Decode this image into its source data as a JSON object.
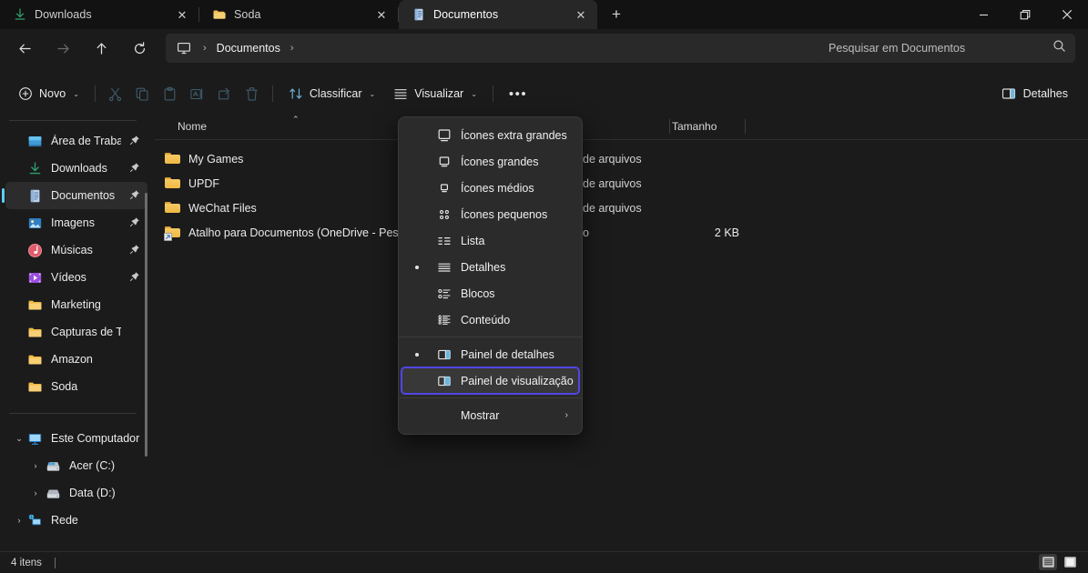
{
  "window": {
    "controls": [
      {
        "name": "minimize",
        "label": "—"
      },
      {
        "name": "maximize",
        "label": "❐"
      },
      {
        "name": "close",
        "label": "✕"
      }
    ]
  },
  "tabs": {
    "items": [
      {
        "label": "Downloads",
        "icon": "download-icon",
        "active": false,
        "close": "✕"
      },
      {
        "label": "Soda",
        "icon": "folder-icon",
        "active": false,
        "close": "✕"
      },
      {
        "label": "Documentos",
        "icon": "documents-icon",
        "active": true,
        "close": "✕"
      }
    ],
    "new_tab_label": "+"
  },
  "address": {
    "back": "back-arrow",
    "forward": "forward-arrow",
    "up": "up-arrow",
    "refresh": "refresh-icon",
    "crumb_icon": "this-pc-icon",
    "crumb_text": "Documentos",
    "sep": "›"
  },
  "search": {
    "placeholder": "Pesquisar em Documentos",
    "value": "",
    "icon": "search-icon"
  },
  "toolbar": {
    "new_label": "Novo",
    "new_chevron": "⌄",
    "cut_label": "Recortar",
    "copy_label": "Copiar",
    "paste_label": "Colar",
    "rename_label": "Renomear",
    "share_label": "Compartilhar",
    "delete_label": "Excluir",
    "sort_label": "Classificar",
    "view_label": "Visualizar",
    "overflow_label": "•••",
    "details_label": "Detalhes"
  },
  "sidebar": {
    "items": [
      {
        "label": "Área de Trabalho",
        "icon": "desktop-icon",
        "pinned": true,
        "selected": false,
        "expander": ""
      },
      {
        "label": "Downloads",
        "icon": "download-icon",
        "pinned": true,
        "selected": false,
        "expander": ""
      },
      {
        "label": "Documentos",
        "icon": "documents-icon",
        "pinned": true,
        "selected": true,
        "expander": ""
      },
      {
        "label": "Imagens",
        "icon": "pictures-icon",
        "pinned": true,
        "selected": false,
        "expander": ""
      },
      {
        "label": "Músicas",
        "icon": "music-icon",
        "pinned": true,
        "selected": false,
        "expander": ""
      },
      {
        "label": "Vídeos",
        "icon": "videos-icon",
        "pinned": true,
        "selected": false,
        "expander": ""
      },
      {
        "label": "Marketing",
        "icon": "folder-icon",
        "pinned": false,
        "selected": false,
        "expander": ""
      },
      {
        "label": "Capturas de Tela",
        "icon": "folder-icon",
        "pinned": false,
        "selected": false,
        "expander": ""
      },
      {
        "label": "Amazon",
        "icon": "folder-icon",
        "pinned": false,
        "selected": false,
        "expander": ""
      },
      {
        "label": "Soda",
        "icon": "folder-icon",
        "pinned": false,
        "selected": false,
        "expander": ""
      }
    ],
    "tree": [
      {
        "label": "Este Computador",
        "icon": "this-pc-icon",
        "expander": "⌄",
        "indent": 0
      },
      {
        "label": "Acer (C:)",
        "icon": "windows-drive-icon",
        "expander": "›",
        "indent": 1
      },
      {
        "label": "Data (D:)",
        "icon": "drive-icon",
        "expander": "›",
        "indent": 1
      },
      {
        "label": "Rede",
        "icon": "network-icon",
        "expander": "›",
        "indent": 0
      }
    ],
    "pin_glyph": "📌"
  },
  "filelist": {
    "columns": [
      {
        "key": "name",
        "label": "Nome",
        "sorted": true,
        "sort_caret": "⌃"
      },
      {
        "key": "size",
        "label": "Tamanho",
        "sorted": false,
        "sort_caret": ""
      }
    ],
    "rows": [
      {
        "name": "My Games",
        "icon": "folder-icon",
        "type": "de arquivos",
        "size": ""
      },
      {
        "name": "UPDF",
        "icon": "folder-icon",
        "type": "de arquivos",
        "size": ""
      },
      {
        "name": "WeChat Files",
        "icon": "folder-icon",
        "type": "de arquivos",
        "size": ""
      },
      {
        "name": "Atalho para Documentos (OneDrive  - Pessoal)",
        "icon": "folder-shortcut-icon",
        "type": "o",
        "size": "2 KB"
      }
    ]
  },
  "view_menu": {
    "groups": [
      {
        "items": [
          {
            "label": "Ícones extra grandes",
            "icon": "xl-icons-icon",
            "checked": false,
            "focused": false,
            "submenu": ""
          },
          {
            "label": "Ícones grandes",
            "icon": "large-icons-icon",
            "checked": false,
            "focused": false,
            "submenu": ""
          },
          {
            "label": "Ícones médios",
            "icon": "medium-icons-icon",
            "checked": false,
            "focused": false,
            "submenu": ""
          },
          {
            "label": "Ícones pequenos",
            "icon": "small-icons-icon",
            "checked": false,
            "focused": false,
            "submenu": ""
          },
          {
            "label": "Lista",
            "icon": "list-icon",
            "checked": false,
            "focused": false,
            "submenu": ""
          },
          {
            "label": "Detalhes",
            "icon": "details-icon",
            "checked": true,
            "focused": false,
            "submenu": ""
          },
          {
            "label": "Blocos",
            "icon": "tiles-icon",
            "checked": false,
            "focused": false,
            "submenu": ""
          },
          {
            "label": "Conteúdo",
            "icon": "content-icon",
            "checked": false,
            "focused": false,
            "submenu": ""
          }
        ]
      },
      {
        "items": [
          {
            "label": "Painel de detalhes",
            "icon": "details-pane-icon",
            "checked": true,
            "focused": false,
            "submenu": ""
          },
          {
            "label": "Painel de visualização",
            "icon": "preview-pane-icon",
            "checked": false,
            "focused": true,
            "submenu": ""
          }
        ]
      },
      {
        "items": [
          {
            "label": "Mostrar",
            "icon": "",
            "checked": false,
            "focused": false,
            "submenu": "›"
          }
        ]
      }
    ]
  },
  "statusbar": {
    "item_count": "4 itens",
    "view_details_label": "Exibição de detalhes",
    "view_icons_label": "Exibição de ícones grandes"
  },
  "colors": {
    "window_bg": "#1b1b1b",
    "tabstrip_bg": "#121212",
    "active_tab_bg": "#272727",
    "field_bg": "#292929",
    "menu_bg": "#2b2b2b",
    "focus_outline": "#4f46e5",
    "accent": "#60cdff",
    "folder_yellow": "#f5c964"
  }
}
